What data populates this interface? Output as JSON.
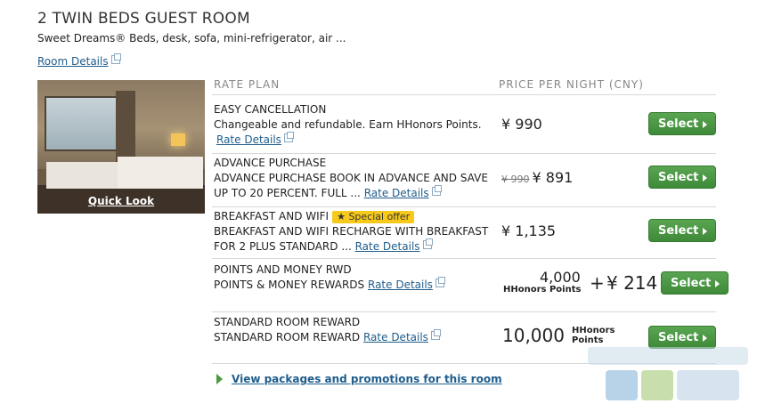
{
  "room": {
    "title": "2 TWIN BEDS GUEST ROOM",
    "description": "Sweet Dreams® Beds, desk, sofa, mini-refrigerator, air ...",
    "details_link": "Room Details",
    "quick_look": "Quick Look"
  },
  "table": {
    "headers": [
      "RATE PLAN",
      "PRICE PER NIGHT (CNY)"
    ],
    "select_label": "Select",
    "rate_details_label": "Rate Details",
    "rows": [
      {
        "name": "EASY CANCELLATION",
        "desc": "Changeable and refundable. Earn HHonors Points.",
        "desc2": "",
        "price": "¥ 990"
      },
      {
        "name": "ADVANCE PURCHASE",
        "desc": "ADVANCE PURCHASE BOOK IN ADVANCE AND SAVE",
        "desc2": "UP TO 20 PERCENT. FULL ...",
        "old_price": "¥ 990",
        "price": "¥ 891"
      },
      {
        "name": "BREAKFAST AND WIFI",
        "badge": "★ Special offer",
        "desc": "BREAKFAST AND WIFI RECHARGE WITH BREAKFAST",
        "desc2": "FOR 2 PLUS STANDARD ...",
        "price": "¥ 1,135"
      },
      {
        "name": "POINTS AND MONEY RWD",
        "desc": "POINTS & MONEY REWARDS",
        "points": "4,000",
        "points_label": "HHonors Points",
        "plus": "+",
        "price": "¥ 214"
      },
      {
        "name": "STANDARD ROOM REWARD",
        "desc": "STANDARD ROOM REWARD",
        "points": "10,000",
        "points_label_1": "HHonors",
        "points_label_2": "Points"
      }
    ]
  },
  "footer": {
    "packages_link": "View packages and promotions for this room"
  },
  "colors": {
    "button": "#3f8a3a",
    "link": "#1f5d8c",
    "badge": "#f6c91a"
  }
}
